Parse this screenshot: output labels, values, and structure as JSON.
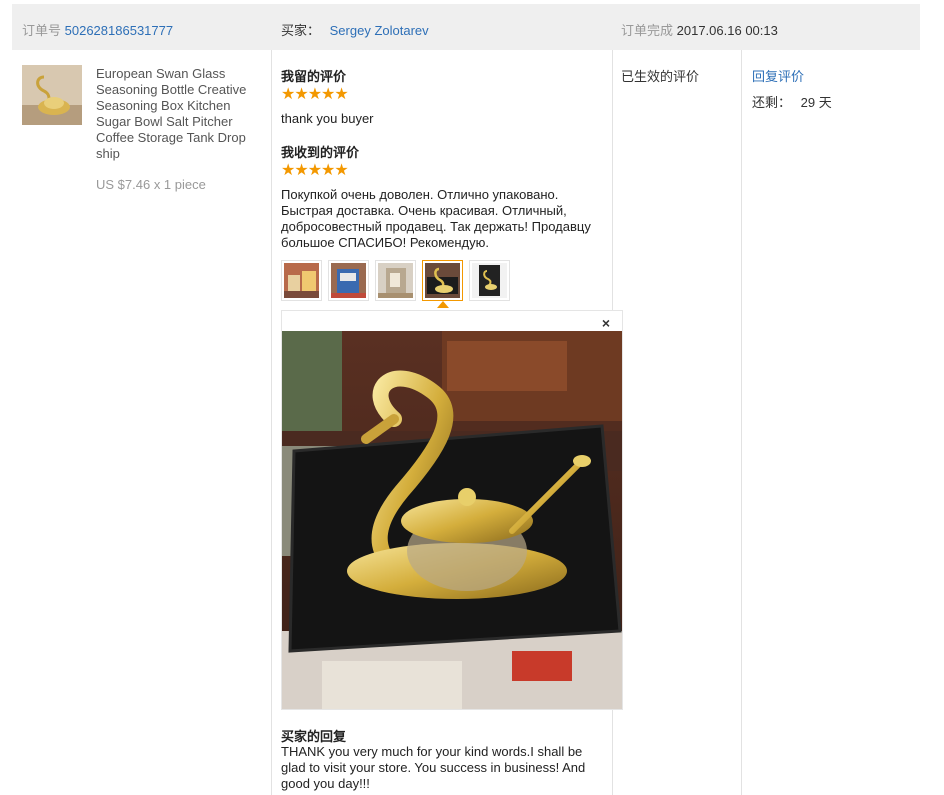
{
  "header": {
    "order_label": "订单号",
    "order_number": "502628186531777",
    "buyer_label": "买家：",
    "buyer_name": "Sergey Zolotarev",
    "completed_label": "订单完成",
    "completed_time": "2017.06.16 00:13"
  },
  "product": {
    "title": "European Swan Glass Seasoning Bottle Creative Seasoning Box Kitchen Sugar Bowl Salt Pitcher Coffee Storage Tank Drop ship",
    "price": "US $7.46 x 1 piece"
  },
  "my_review": {
    "title": "我留的评价",
    "stars": "★★★★★",
    "rating": 5,
    "text": "thank you buyer"
  },
  "received_review": {
    "title": "我收到的评价",
    "stars": "★★★★★",
    "rating": 5,
    "text": "Покупкой очень доволен. Отлично упаковано. Быстрая доставка. Очень красивая. Отличный, добросовестный продавец. Так держать! Продавцу большое СПАСИБО! Рекомендую."
  },
  "photos": {
    "count": 5,
    "selected_index": 4,
    "close_symbol": "×"
  },
  "buyer_reply": {
    "title": "买家的回复",
    "text": "THANK you very much for your kind words.I shall be glad to visit your store. You success in business! And good you day!!!"
  },
  "status": {
    "label": "已生效的评价"
  },
  "actions": {
    "reply_label": "回复评价",
    "remaining_label": "还剩：",
    "remaining_value": "29 天"
  },
  "colors": {
    "link": "#2d6fb7",
    "star": "#f39800",
    "header_bg": "#efefef"
  }
}
